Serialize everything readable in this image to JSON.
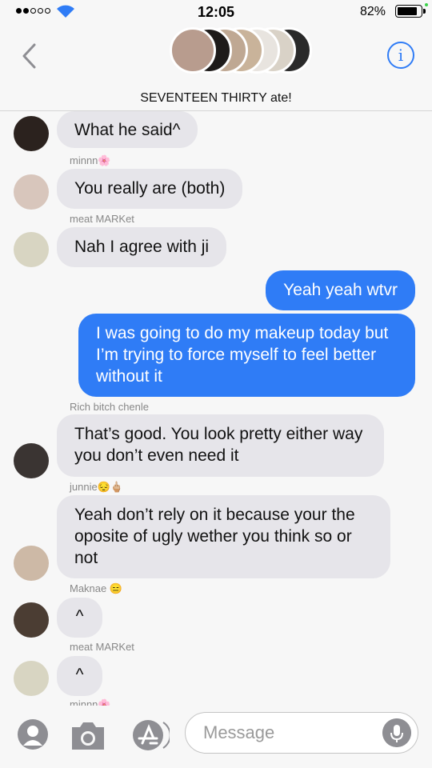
{
  "status_bar": {
    "time": "12:05",
    "battery_pct": "82%",
    "battery_level": 0.82,
    "signal_bars": 2
  },
  "header": {
    "group_name": "SEVENTEEN THIRTY ate!"
  },
  "messages": [
    {
      "sender": "",
      "text": "What he said^"
    },
    {
      "sender": "minnn🌸",
      "text": "You really are (both)"
    },
    {
      "sender": "meat MARKet",
      "text": "Nah I agree with ji"
    },
    {
      "text": "Yeah yeah wtvr"
    },
    {
      "text": "I was going to do my makeup today but I’m trying to force myself to feel better without it"
    },
    {
      "sender": "Rich bitch chenle",
      "text": "That’s good. You look pretty either way you don’t even need it"
    },
    {
      "sender": "junnie😔🖕🏼",
      "text": "Yeah don’t rely on it because your the oposite of ugly wether you think so or not"
    },
    {
      "sender": "Maknae 😑",
      "text": "^"
    },
    {
      "sender": "meat MARKet",
      "text": "^"
    },
    {
      "sender": "minnn🌸"
    }
  ],
  "input": {
    "placeholder": "Message"
  },
  "colors": {
    "accent": "#2f7cf6",
    "incoming_bubble": "#e6e5ea"
  }
}
